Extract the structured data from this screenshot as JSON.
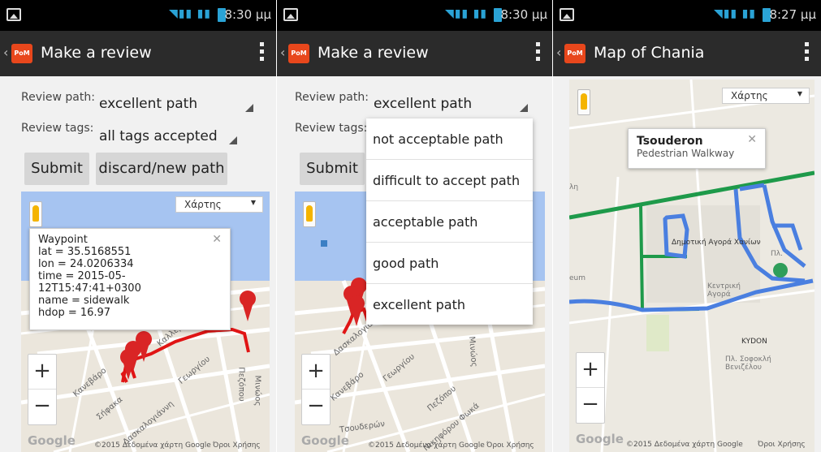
{
  "screens": [
    {
      "status": {
        "time": "8:30 μμ"
      },
      "title": "Make a review",
      "form": {
        "path_label": "Review path:",
        "path_value": "excellent path",
        "tags_label": "Review tags:",
        "tags_value": "all tags accepted",
        "submit": "Submit",
        "discard": "discard/new path"
      },
      "map": {
        "type_selector": "Χάρτης",
        "zoom_in": "+",
        "zoom_out": "−",
        "attribution": "©2015 Δεδομένα χάρτη Google",
        "terms": "Όροι Χρήσης",
        "logo": "Google",
        "street_labels": [
          "Καλλέρ",
          "Κανεβάρο",
          "Σήφακα",
          "Δασκαλογιάννη",
          "Γεωργίου",
          "Πεζόπου",
          "Μινώος"
        ]
      },
      "infowindow": {
        "title": "Waypoint",
        "lines": [
          "lat = 35.5168551",
          "lon = 24.0206334",
          "time = 2015-05-",
          "12T15:47:41+0300",
          "name = sidewalk",
          "hdop = 16.97"
        ]
      }
    },
    {
      "status": {
        "time": "8:30 μμ"
      },
      "title": "Make a review",
      "form": {
        "path_label": "Review path:",
        "path_value": "excellent path",
        "tags_label": "Review tags:",
        "submit": "Submit"
      },
      "dropdown_options": [
        "not acceptable path",
        "difficult to accept path",
        "acceptable path",
        "good path",
        "excellent path"
      ],
      "map": {
        "zoom_in": "+",
        "zoom_out": "−",
        "attribution": "©2015 Δεδομένα χάρτη Google",
        "terms": "Όροι Χρήσης",
        "logo": "Google",
        "street_labels": [
          "Δασκαλογιάννη",
          "Κανεβάρο",
          "Γεωργίου",
          "Πεζόπου",
          "Νικηφόρου Φωκά",
          "Τσουδερών",
          "Μινώος"
        ]
      }
    },
    {
      "status": {
        "time": "8:27 μμ"
      },
      "title": "Map of Chania",
      "map": {
        "type_selector": "Χάρτης",
        "zoom_in": "+",
        "zoom_out": "−",
        "attribution": "©2015 Δεδομένα χάρτη Google",
        "terms": "Όροι Χρήσης",
        "logo": "Google",
        "labels": {
          "agora": "Δημοτική Αγορά Χανίων",
          "central_agora": "Κεντρική Αγορά",
          "kydon": "KYDON",
          "square": "Πλ. Σοφοκλή Βενιζέλου",
          "pl": "Πλ.",
          "left_a": "λη",
          "left_b": "eum"
        }
      },
      "infowindow": {
        "title": "Tsouderon",
        "subtitle": "Pedestrian Walkway"
      }
    }
  ],
  "colors": {
    "status_bar": "#000000",
    "action_bar": "#2b2b2b",
    "logo": "#e8471c",
    "track_red": "#e01515",
    "route_green": "#1e9a4a",
    "route_blue": "#4a7fe0",
    "sea": "#a6c4f1"
  }
}
